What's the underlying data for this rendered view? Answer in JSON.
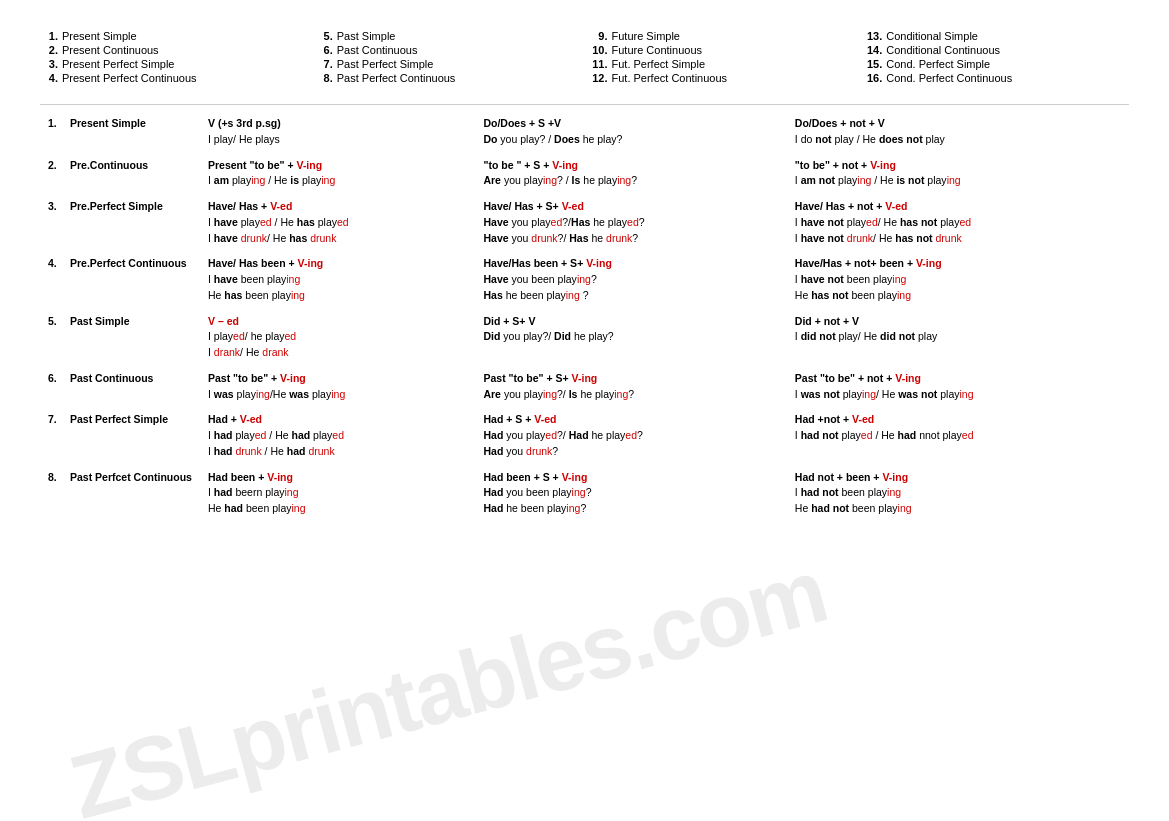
{
  "watermark": "ZSLprintables.com",
  "topList": {
    "columns": [
      [
        {
          "num": "1.",
          "label": "Present Simple"
        },
        {
          "num": "2.",
          "label": "Present Continuous"
        },
        {
          "num": "3.",
          "label": "Present Perfect Simple"
        },
        {
          "num": "4.",
          "label": "Present Perfect Continuous"
        }
      ],
      [
        {
          "num": "5.",
          "label": "Past Simple"
        },
        {
          "num": "6.",
          "label": "Past Continuous"
        },
        {
          "num": "7.",
          "label": "Past Perfect Simple"
        },
        {
          "num": "8.",
          "label": "Past Perfect Continuous"
        }
      ],
      [
        {
          "num": "9.",
          "label": "Future Simple"
        },
        {
          "num": "10.",
          "label": "Future Continuous"
        },
        {
          "num": "11.",
          "label": "Fut. Perfect Simple"
        },
        {
          "num": "12.",
          "label": "Fut. Perfect Continuous"
        }
      ],
      [
        {
          "num": "13.",
          "label": "Conditional Simple"
        },
        {
          "num": "14.",
          "label": "Conditional Continuous"
        },
        {
          "num": "15.",
          "label": "Cond. Perfect Simple"
        },
        {
          "num": "16.",
          "label": "Cond. Perfect Continuous"
        }
      ]
    ]
  },
  "rows": [
    {
      "num": "1.",
      "label": "Present Simple",
      "affirmative": {
        "formula": "V (+s 3rd p.sg)",
        "examples": [
          "I play/ He plays"
        ]
      },
      "interrogative": {
        "formula": "Do/Does + S +V",
        "examples": [
          "Do you play? / Does he play?"
        ]
      },
      "negative": {
        "formula": "Do/Does + not + V",
        "examples": [
          "I do not play / He does not play"
        ]
      }
    },
    {
      "num": "2.",
      "label": "Pre.Continuous",
      "affirmative": {
        "formula": "Present \"to be\" + V-ing",
        "examples": [
          "I am playing / He is playing"
        ]
      },
      "interrogative": {
        "formula": "\"to be \" + S + V-ing",
        "examples": [
          "Are you playing? / Is he playing?"
        ]
      },
      "negative": {
        "formula": "\"to be\" + not + V-ing",
        "examples": [
          "I am not playing / He is not playing"
        ]
      }
    },
    {
      "num": "3.",
      "label": "Pre.Perfect  Simple",
      "affirmative": {
        "formula": "Have/ Has + V-ed",
        "examples": [
          "I have played / He has played",
          "I have drunk/ He has drunk"
        ]
      },
      "interrogative": {
        "formula": "Have/ Has + S+ V-ed",
        "examples": [
          "Have you played?/Has he played?",
          "Have you drunk?/ Has he drunk?"
        ]
      },
      "negative": {
        "formula": "Have/ Has + not + V-ed",
        "examples": [
          "I have not played/ He has not played",
          "I have not drunk/ He has not drunk"
        ]
      }
    },
    {
      "num": "4.",
      "label": "Pre.Perfect Continuous",
      "affirmative": {
        "formula": "Have/ Has been + V-ing",
        "examples": [
          "I have been playing",
          "He has been playing"
        ]
      },
      "interrogative": {
        "formula": "Have/Has been + S+ V-ing",
        "examples": [
          "Have you been playing?",
          "Has he been playing ?"
        ]
      },
      "negative": {
        "formula": "Have/Has + not+ been + V-ing",
        "examples": [
          "I have not been playing",
          "He has not been playing"
        ]
      }
    },
    {
      "num": "5.",
      "label": "Past Simple",
      "affirmative": {
        "formula": "V – ed",
        "examples": [
          "I played/ he played",
          "I drank/ He drank"
        ]
      },
      "interrogative": {
        "formula": "Did + S+ V",
        "examples": [
          "Did you play?/ Did he play?"
        ]
      },
      "negative": {
        "formula": "Did + not + V",
        "examples": [
          "I did not play/ He did not play"
        ]
      }
    },
    {
      "num": "6.",
      "label": "Past Continuous",
      "affirmative": {
        "formula": "Past \"to be\" + V-ing",
        "examples": [
          "I was playing/He was playing"
        ]
      },
      "interrogative": {
        "formula": "Past \"to be\" + S+ V-ing",
        "examples": [
          "Are you playing?/ Is he playing?"
        ]
      },
      "negative": {
        "formula": "Past \"to be\" + not + V-ing",
        "examples": [
          "I was not playing/ He was not playing"
        ]
      }
    },
    {
      "num": "7.",
      "label": "Past Perfect Simple",
      "affirmative": {
        "formula": "Had + V-ed",
        "examples": [
          "I had played / He had played",
          "I had drunk / He had drunk"
        ]
      },
      "interrogative": {
        "formula": "Had + S + V-ed",
        "examples": [
          "Had you played?/ Had he played?",
          "Had you drunk?"
        ]
      },
      "negative": {
        "formula": "Had +not + V-ed",
        "examples": [
          "I had not played / He had nnot played"
        ]
      }
    },
    {
      "num": "8.",
      "label": "Past Perfcet Continuous",
      "affirmative": {
        "formula": "Had been + V-ing",
        "examples": [
          "I had beern playing",
          "He had been playing"
        ]
      },
      "interrogative": {
        "formula": "Had been + S + V-ing",
        "examples": [
          "Had you been playing?",
          "Had he been playing?"
        ]
      },
      "negative": {
        "formula": "Had not + been + V-ing",
        "examples": [
          "I had not been playing",
          "He had not been playing"
        ]
      }
    }
  ]
}
